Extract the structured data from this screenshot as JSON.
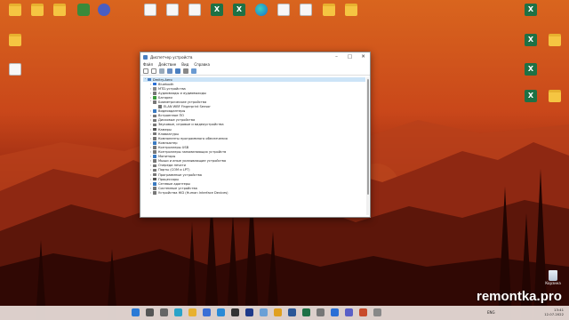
{
  "desktop": {
    "top_icons": [
      {
        "label": "",
        "kind": "folder"
      },
      {
        "label": "",
        "kind": "folder"
      },
      {
        "label": "",
        "kind": "folder"
      },
      {
        "label": "",
        "kind": "app-green"
      },
      {
        "label": "",
        "kind": "app-rocket"
      },
      {
        "label": "",
        "kind": "doc"
      },
      {
        "label": "",
        "kind": "doc"
      },
      {
        "label": "",
        "kind": "doc"
      },
      {
        "label": "",
        "kind": "xls"
      },
      {
        "label": "",
        "kind": "xls"
      },
      {
        "label": "",
        "kind": "edge"
      },
      {
        "label": "",
        "kind": "doc"
      },
      {
        "label": "",
        "kind": "doc"
      },
      {
        "label": "",
        "kind": "folder"
      },
      {
        "label": "",
        "kind": "folder"
      }
    ],
    "left_icons": [
      {
        "label": "",
        "kind": "folder"
      },
      {
        "label": "",
        "kind": "doc"
      }
    ],
    "right_icons": [
      {
        "label": "",
        "kind": "xls"
      },
      {
        "label": "",
        "kind": "xls"
      },
      {
        "label": "",
        "kind": "folder"
      },
      {
        "label": "",
        "kind": "xls"
      },
      {
        "label": "",
        "kind": "xls"
      },
      {
        "label": "",
        "kind": "folder"
      }
    ],
    "recycle_bin": "Корзина",
    "watermark": "remontka.pro"
  },
  "window": {
    "title": "Диспетчер устройств",
    "menu": [
      "Файл",
      "Действие",
      "Вид",
      "Справка"
    ],
    "tree": [
      {
        "label": "Dmitry-Aero",
        "level": 0,
        "expander": "v",
        "color": "#4a7fc1",
        "selected": true
      },
      {
        "label": "Bluetooth",
        "level": 1,
        "expander": ">",
        "color": "#2a6fd6"
      },
      {
        "label": "MTD-устройства",
        "level": 1,
        "expander": ">",
        "color": "#888"
      },
      {
        "label": "Аудиовходы и аудиовыходы",
        "level": 1,
        "expander": ">",
        "color": "#777"
      },
      {
        "label": "Батареи",
        "level": 1,
        "expander": ">",
        "color": "#3a9a3a"
      },
      {
        "label": "Биометрические устройства",
        "level": 1,
        "expander": "v",
        "color": "#777"
      },
      {
        "label": "ELAN WBF Fingerprint Sensor",
        "level": 2,
        "expander": "",
        "color": "#777"
      },
      {
        "label": "Видеоадаптеры",
        "level": 1,
        "expander": ">",
        "color": "#3a7ac1"
      },
      {
        "label": "Встроенное ПО",
        "level": 1,
        "expander": ">",
        "color": "#777"
      },
      {
        "label": "Дисковые устройства",
        "level": 1,
        "expander": ">",
        "color": "#777"
      },
      {
        "label": "Звуковые, игровые и видеоустройства",
        "level": 1,
        "expander": ">",
        "color": "#777"
      },
      {
        "label": "Камеры",
        "level": 1,
        "expander": ">",
        "color": "#555"
      },
      {
        "label": "Клавиатуры",
        "level": 1,
        "expander": ">",
        "color": "#777"
      },
      {
        "label": "Компоненты программного обеспечения",
        "level": 1,
        "expander": ">",
        "color": "#777"
      },
      {
        "label": "Компьютер",
        "level": 1,
        "expander": ">",
        "color": "#3a7ac1"
      },
      {
        "label": "Контроллеры USB",
        "level": 1,
        "expander": ">",
        "color": "#777"
      },
      {
        "label": "Контроллеры запоминающих устройств",
        "level": 1,
        "expander": ">",
        "color": "#777"
      },
      {
        "label": "Мониторы",
        "level": 1,
        "expander": ">",
        "color": "#3a7ac1"
      },
      {
        "label": "Мыши и иные указывающие устройства",
        "level": 1,
        "expander": ">",
        "color": "#777"
      },
      {
        "label": "Очереди печати",
        "level": 1,
        "expander": ">",
        "color": "#777"
      },
      {
        "label": "Порты (COM и LPT)",
        "level": 1,
        "expander": ">",
        "color": "#777"
      },
      {
        "label": "Программные устройства",
        "level": 1,
        "expander": ">",
        "color": "#777"
      },
      {
        "label": "Процессоры",
        "level": 1,
        "expander": ">",
        "color": "#555"
      },
      {
        "label": "Сетевые адаптеры",
        "level": 1,
        "expander": ">",
        "color": "#3a7ac1"
      },
      {
        "label": "Системные устройства",
        "level": 1,
        "expander": ">",
        "color": "#777"
      },
      {
        "label": "Устройства HID (Human Interface Devices)",
        "level": 1,
        "expander": ">",
        "color": "#777"
      }
    ]
  },
  "taskbar": {
    "apps": [
      "windows-icon",
      "search-icon",
      "task-view-icon",
      "edge-icon",
      "explorer-icon",
      "store-icon",
      "vscode-icon",
      "terminal-icon",
      "photoshop-icon",
      "notepad-icon",
      "chrome-icon",
      "word-icon",
      "excel-icon",
      "settings-icon",
      "mail-icon",
      "teams-icon",
      "app-icon",
      "app-icon"
    ],
    "lang": "ENG",
    "time": "13:41",
    "date": "12.07.2022"
  }
}
